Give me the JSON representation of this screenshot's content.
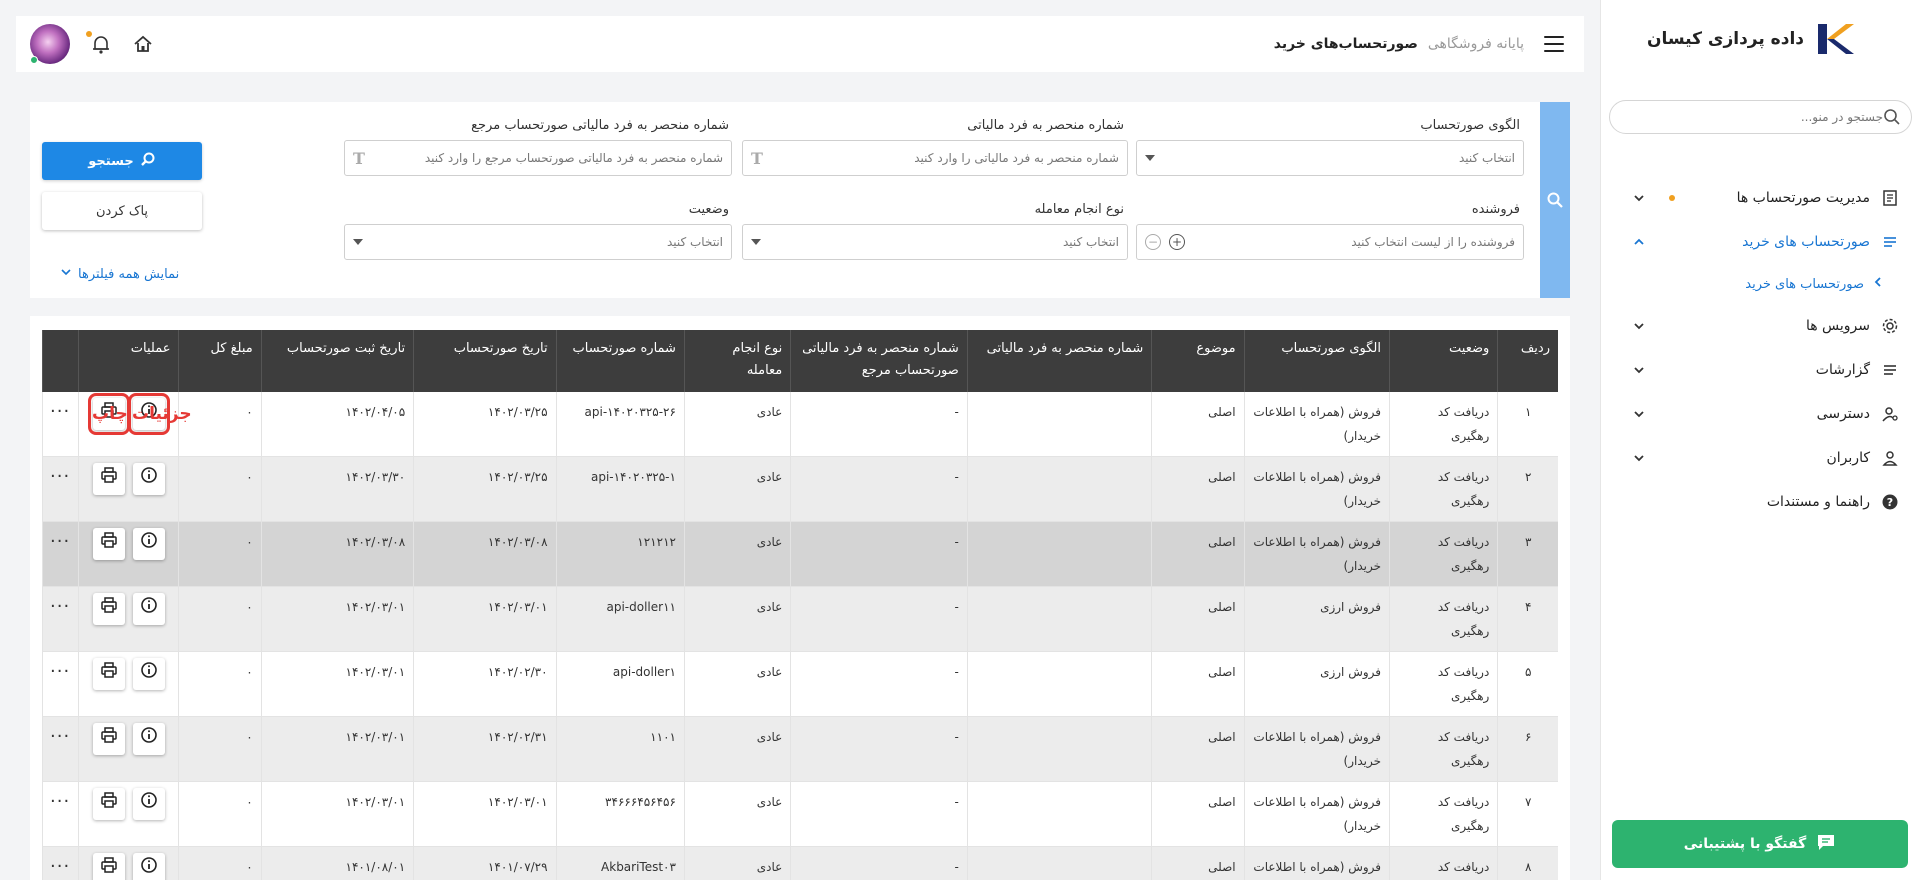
{
  "brand": {
    "name": "داده پردازی کیسان",
    "logo_colors": [
      "#f0a020",
      "#1a2a6c"
    ]
  },
  "sidebar": {
    "search_placeholder": "جستجو در منو...",
    "items": [
      {
        "label": "مدیریت صورتحساب ها",
        "icon": "invoice-icon",
        "has_dot": true
      },
      {
        "label": "صورتحساب های خرید",
        "icon": "list-icon",
        "active": true
      },
      {
        "label": "سرویس ها",
        "icon": "gear-icon"
      },
      {
        "label": "گزارشات",
        "icon": "report-icon"
      },
      {
        "label": "دسترسی",
        "icon": "access-icon"
      },
      {
        "label": "کاربران",
        "icon": "user-icon"
      },
      {
        "label": "راهنما و مستندات",
        "icon": "help-icon"
      }
    ],
    "submenu_label": "صورتحساب های خرید",
    "support_label": "گفتگو با پشتیبانی"
  },
  "header": {
    "breadcrumb_parent": "پایانه فروشگاهی",
    "breadcrumb_current": "صورتحساب‌های خرید"
  },
  "filters": {
    "pattern_label": "الگوی صورتحساب",
    "pattern_placeholder": "انتخاب کنید",
    "tax_id_label": "شماره منحصر به فرد مالیاتی",
    "tax_id_placeholder": "شماره منحصر به فرد مالیاتی را وارد کنید",
    "ref_tax_id_label": "شماره منحصر به فرد مالیاتی صورتحساب مرجع",
    "ref_tax_id_placeholder": "شماره منحصر به فرد مالیاتی صورتحساب مرجع را وارد کنید",
    "seller_label": "فروشنده",
    "seller_placeholder": "فروشنده را از لیست انتخاب کنید",
    "deal_type_label": "نوع انجام معامله",
    "deal_type_placeholder": "انتخاب کنید",
    "status_label": "وضعیت",
    "status_placeholder": "انتخاب کنید",
    "search_button": "جستجو",
    "clear_button": "پاک کردن",
    "show_all": "نمایش همه فیلترها"
  },
  "table": {
    "headers": [
      "ردیف",
      "وضعیت",
      "الگوی صورتحساب",
      "موضوع",
      "شماره منحصر به فرد مالیاتی",
      "شماره منحصر به فرد مالیاتی صورتحساب مرجع",
      "نوع انجام معامله",
      "شماره صورتحساب",
      "تاریخ صورتحساب",
      "تاریخ ثبت صورتحساب",
      "مبلغ کل",
      "عملیات",
      ""
    ],
    "rows": [
      {
        "row": "۱",
        "status": "دریافت کد رهگیری",
        "pattern": "فروش (همراه با اطلاعات خریدار)",
        "subject": "اصلی",
        "tax_id": "",
        "ref_tax_id": "-",
        "deal_type": "عادی",
        "invoice_no": "api-۱۴۰۲۰۳۲۵-۲۶",
        "invoice_date": "۱۴۰۲/۰۳/۲۵",
        "reg_date": "۱۴۰۲/۰۴/۰۵",
        "amount": "۰"
      },
      {
        "row": "۲",
        "status": "دریافت کد رهگیری",
        "pattern": "فروش (همراه با اطلاعات خریدار)",
        "subject": "اصلی",
        "tax_id": "",
        "ref_tax_id": "-",
        "deal_type": "عادی",
        "invoice_no": "api-۱۴۰۲۰۳۲۵-۱",
        "invoice_date": "۱۴۰۲/۰۳/۲۵",
        "reg_date": "۱۴۰۲/۰۳/۳۰",
        "amount": "۰"
      },
      {
        "row": "۳",
        "status": "دریافت کد رهگیری",
        "pattern": "فروش (همراه با اطلاعات خریدار)",
        "subject": "اصلی",
        "tax_id": "",
        "ref_tax_id": "-",
        "deal_type": "عادی",
        "invoice_no": "۱۲۱۲۱۲",
        "invoice_date": "۱۴۰۲/۰۳/۰۸",
        "reg_date": "۱۴۰۲/۰۳/۰۸",
        "amount": "۰"
      },
      {
        "row": "۴",
        "status": "دریافت کد رهگیری",
        "pattern": "فروش ارزی",
        "subject": "اصلی",
        "tax_id": "",
        "ref_tax_id": "-",
        "deal_type": "عادی",
        "invoice_no": "api-doller۱۱",
        "invoice_date": "۱۴۰۲/۰۳/۰۱",
        "reg_date": "۱۴۰۲/۰۳/۰۱",
        "amount": "۰"
      },
      {
        "row": "۵",
        "status": "دریافت کد رهگیری",
        "pattern": "فروش ارزی",
        "subject": "اصلی",
        "tax_id": "",
        "ref_tax_id": "-",
        "deal_type": "عادی",
        "invoice_no": "api-doller۱",
        "invoice_date": "۱۴۰۲/۰۲/۳۰",
        "reg_date": "۱۴۰۲/۰۳/۰۱",
        "amount": "۰"
      },
      {
        "row": "۶",
        "status": "دریافت کد رهگیری",
        "pattern": "فروش (همراه با اطلاعات خریدار)",
        "subject": "اصلی",
        "tax_id": "",
        "ref_tax_id": "-",
        "deal_type": "عادی",
        "invoice_no": "۱۱۰۱",
        "invoice_date": "۱۴۰۲/۰۲/۳۱",
        "reg_date": "۱۴۰۲/۰۳/۰۱",
        "amount": "۰"
      },
      {
        "row": "۷",
        "status": "دریافت کد رهگیری",
        "pattern": "فروش (همراه با اطلاعات خریدار)",
        "subject": "اصلی",
        "tax_id": "",
        "ref_tax_id": "-",
        "deal_type": "عادی",
        "invoice_no": "۳۴۶۶۶۴۵۶۴۵۶",
        "invoice_date": "۱۴۰۲/۰۳/۰۱",
        "reg_date": "۱۴۰۲/۰۳/۰۱",
        "amount": "۰"
      },
      {
        "row": "۸",
        "status": "دریافت کد رهگیری",
        "pattern": "فروش (همراه با اطلاعات خریدار)",
        "subject": "اصلی",
        "tax_id": "",
        "ref_tax_id": "-",
        "deal_type": "عادی",
        "invoice_no": "AkbariTest۰۳",
        "invoice_date": "۱۴۰۱/۰۷/۲۹",
        "reg_date": "۱۴۰۱/۰۸/۰۱",
        "amount": "۰"
      }
    ],
    "annotations": {
      "details": "جزئیات",
      "print": "چاپ"
    }
  },
  "colors": {
    "primary": "#1e88e5",
    "support": "#2db36f",
    "highlight": "#e53935",
    "header_bg": "#3d3d3d"
  }
}
